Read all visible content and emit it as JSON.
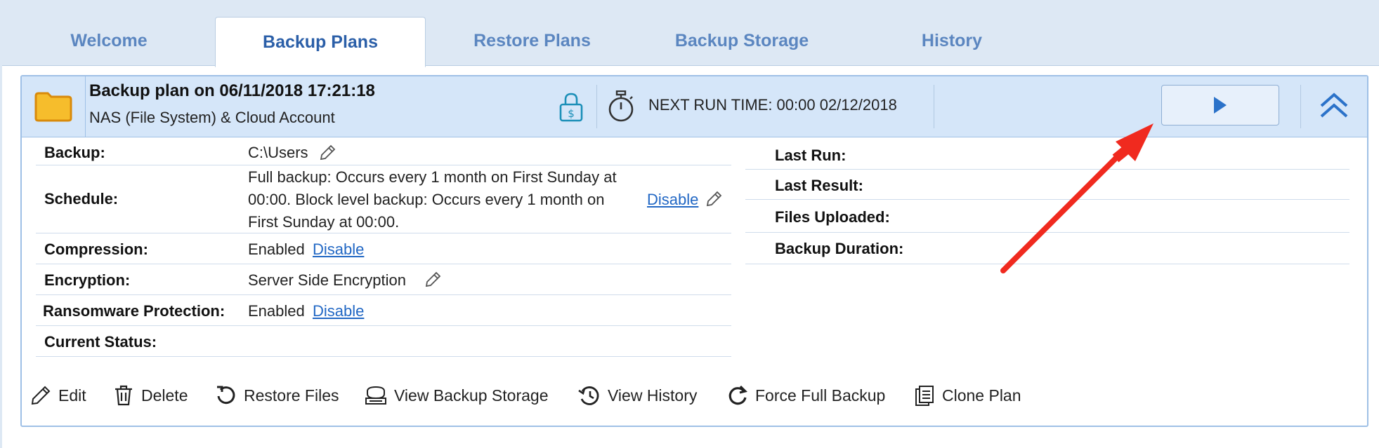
{
  "tabs": [
    {
      "label": "Welcome",
      "active": false
    },
    {
      "label": "Backup Plans",
      "active": true
    },
    {
      "label": "Restore Plans",
      "active": false
    },
    {
      "label": "Backup Storage",
      "active": false
    },
    {
      "label": "History",
      "active": false
    }
  ],
  "plan": {
    "title": "Backup plan on 06/11/2018 17:21:18",
    "subtitle": "NAS (File System) & Cloud Account",
    "next_run": "NEXT RUN TIME: 00:00 02/12/2018"
  },
  "details": {
    "backup": {
      "label": "Backup:",
      "value": "C:\\Users"
    },
    "schedule": {
      "label": "Schedule:",
      "line1": "Full backup: Occurs every 1 month on First Sunday at",
      "line2": "00:00. Block level backup: Occurs every 1 month on",
      "line3": "First Sunday at 00:00.",
      "link": "Disable"
    },
    "compression": {
      "label": "Compression:",
      "value": "Enabled",
      "link": "Disable"
    },
    "encryption": {
      "label": "Encryption:",
      "value": "Server Side Encryption"
    },
    "ransomware": {
      "label": "Ransomware Protection:",
      "value": "Enabled",
      "link": "Disable"
    },
    "current_status": {
      "label": "Current Status:"
    }
  },
  "stats": {
    "last_run": "Last Run:",
    "last_result": "Last Result:",
    "files_uploaded": "Files Uploaded:",
    "backup_duration": "Backup Duration:"
  },
  "toolbar": {
    "edit": "Edit",
    "delete": "Delete",
    "restore_files": "Restore Files",
    "view_backup_storage": "View Backup Storage",
    "view_history": "View History",
    "force_full_backup": "Force Full Backup",
    "clone_plan": "Clone Plan"
  },
  "colors": {
    "accent": "#2b5fa8",
    "link": "#2167c4",
    "header_bg": "#d5e6f9",
    "annotation": "#f02a1f",
    "folder": "#f6bd2c"
  },
  "icons": [
    "folder-icon",
    "lock-dollar-icon",
    "stopwatch-icon",
    "play-icon",
    "double-chevron-up-icon",
    "pencil-icon",
    "trash-icon",
    "restore-icon",
    "storage-icon",
    "history-icon",
    "refresh-icon",
    "clone-icon",
    "red-arrow-annotation"
  ]
}
